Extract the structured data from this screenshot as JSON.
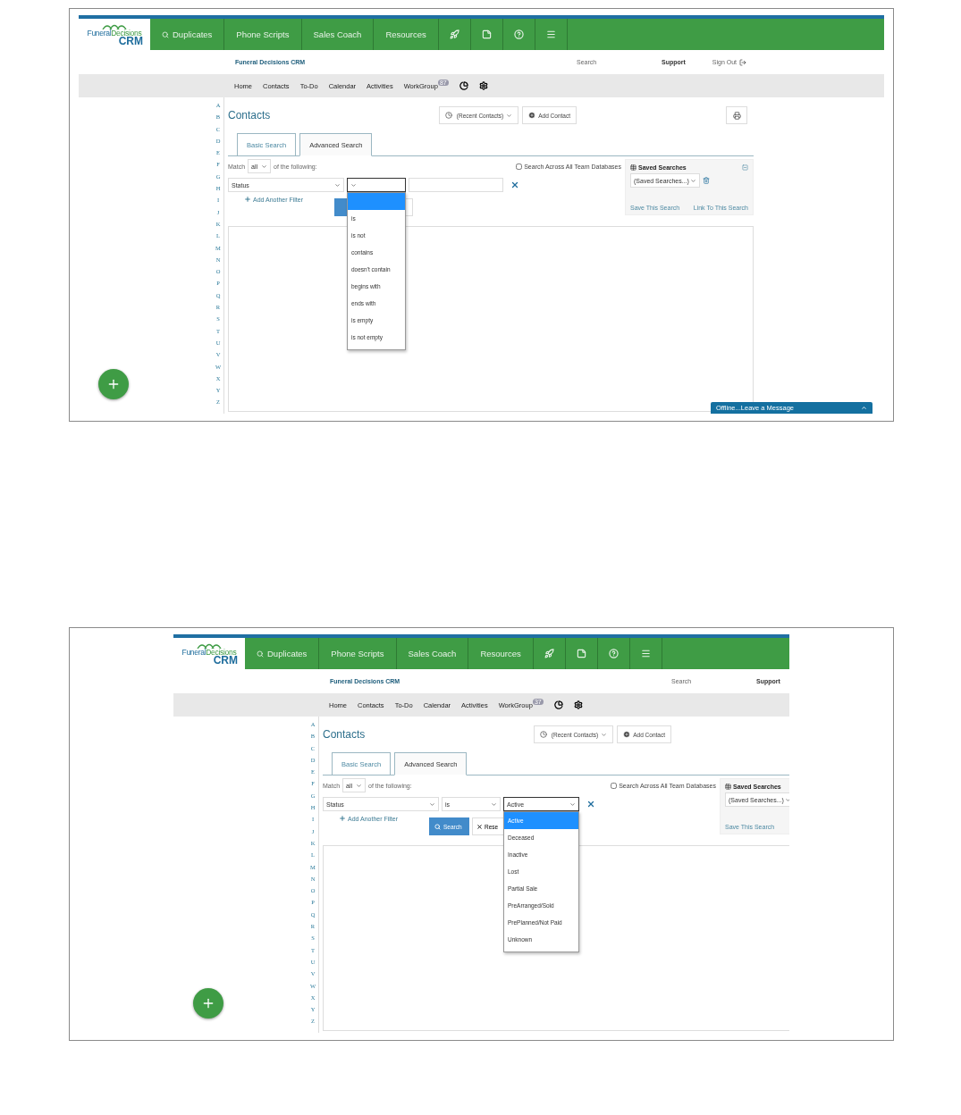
{
  "screens": [
    {
      "logo": {
        "word1": "Funeral",
        "word2": "Decisions",
        "word3": "CRM"
      },
      "nav": [
        "Duplicates",
        "Phone Scripts",
        "Sales Coach",
        "Resources"
      ],
      "brand": "Funeral Decisions CRM",
      "search": "Search",
      "support": "Support",
      "sign_out": "Sign Out",
      "menu": [
        "Home",
        "Contacts",
        "To-Do",
        "Calendar",
        "Activities"
      ],
      "workgroup": {
        "label": "WorkGroup",
        "badge": "87"
      },
      "letters": [
        "A",
        "B",
        "C",
        "D",
        "E",
        "F",
        "G",
        "H",
        "I",
        "J",
        "K",
        "L",
        "M",
        "N",
        "O",
        "P",
        "Q",
        "R",
        "S",
        "T",
        "U",
        "V",
        "W",
        "X",
        "Y",
        "Z"
      ],
      "title": "Contacts",
      "recent": "(Recent Contacts)",
      "add_contact": "Add Contact",
      "print_button": true,
      "tabs": [
        {
          "label": "Basic Search",
          "selected": false
        },
        {
          "label": "Advanced Search",
          "selected": true
        }
      ],
      "match": {
        "label": "Match",
        "value": "all",
        "suffix": "of the following:"
      },
      "across": {
        "label": "Search Across All Team Databases",
        "checked": false
      },
      "filter": {
        "field": {
          "value": "Status"
        },
        "operator": {
          "open": true,
          "options": [
            {
              "selected": true
            },
            {
              "label": "is",
              "selected": false
            },
            {
              "label": "is not",
              "selected": false
            },
            {
              "label": "contains",
              "selected": false
            },
            {
              "label": "doesn't contain",
              "selected": false
            },
            {
              "label": "begins with",
              "selected": false
            },
            {
              "label": "ends with",
              "selected": false
            },
            {
              "label": "is empty",
              "selected": false
            },
            {
              "label": "is not empty",
              "selected": false
            }
          ]
        },
        "value": {
          "kind": "text",
          "open": false
        }
      },
      "add_filter": "Add Another Filter",
      "saved": {
        "title": "Saved Searches",
        "select": "(Saved Searches...)",
        "save": "Save This Search",
        "link": "Link To This Search"
      },
      "chat": "Offline...Leave a Message"
    },
    {
      "logo": {
        "word1": "Funeral",
        "word2": "Decisions",
        "word3": "CRM"
      },
      "nav": [
        "Duplicates",
        "Phone Scripts",
        "Sales Coach",
        "Resources"
      ],
      "brand": "Funeral Decisions CRM",
      "search": "Search",
      "support": "Support",
      "menu": [
        "Home",
        "Contacts",
        "To-Do",
        "Calendar",
        "Activities"
      ],
      "workgroup": {
        "label": "WorkGroup",
        "badge": "37"
      },
      "letters": [
        "A",
        "B",
        "C",
        "D",
        "E",
        "F",
        "G",
        "H",
        "I",
        "J",
        "K",
        "L",
        "M",
        "N",
        "O",
        "P",
        "Q",
        "R",
        "S",
        "T",
        "U",
        "V",
        "W",
        "X",
        "Y",
        "Z"
      ],
      "title": "Contacts",
      "recent": "(Recent Contacts)",
      "add_contact": "Add Contact",
      "tabs": [
        {
          "label": "Basic Search",
          "selected": false
        },
        {
          "label": "Advanced Search",
          "selected": true
        }
      ],
      "match": {
        "label": "Match",
        "value": "all",
        "suffix": "of the following:"
      },
      "across": {
        "label": "Search Across All Team Databases",
        "checked": false
      },
      "filter": {
        "field": {
          "value": "Status"
        },
        "operator": {
          "value": "is",
          "open": false
        },
        "value": {
          "kind": "select",
          "value": "Active",
          "open": true,
          "options": [
            {
              "label": "Active",
              "selected": true
            },
            {
              "label": "Deceased",
              "selected": false
            },
            {
              "label": "Inactive",
              "selected": false
            },
            {
              "label": "Lost",
              "selected": false
            },
            {
              "label": "Partial Sale",
              "selected": false
            },
            {
              "label": "PreArranged/Sold",
              "selected": false
            },
            {
              "label": "PrePlanned/Not Paid",
              "selected": false
            },
            {
              "label": "Unknown",
              "selected": false
            }
          ]
        }
      },
      "add_filter": "Add Another Filter",
      "buttons": {
        "search": "Search",
        "reset": "Rese"
      },
      "saved": {
        "title": "Saved Searches",
        "select": "(Saved Searches...)",
        "save": "Save This Search"
      }
    }
  ]
}
